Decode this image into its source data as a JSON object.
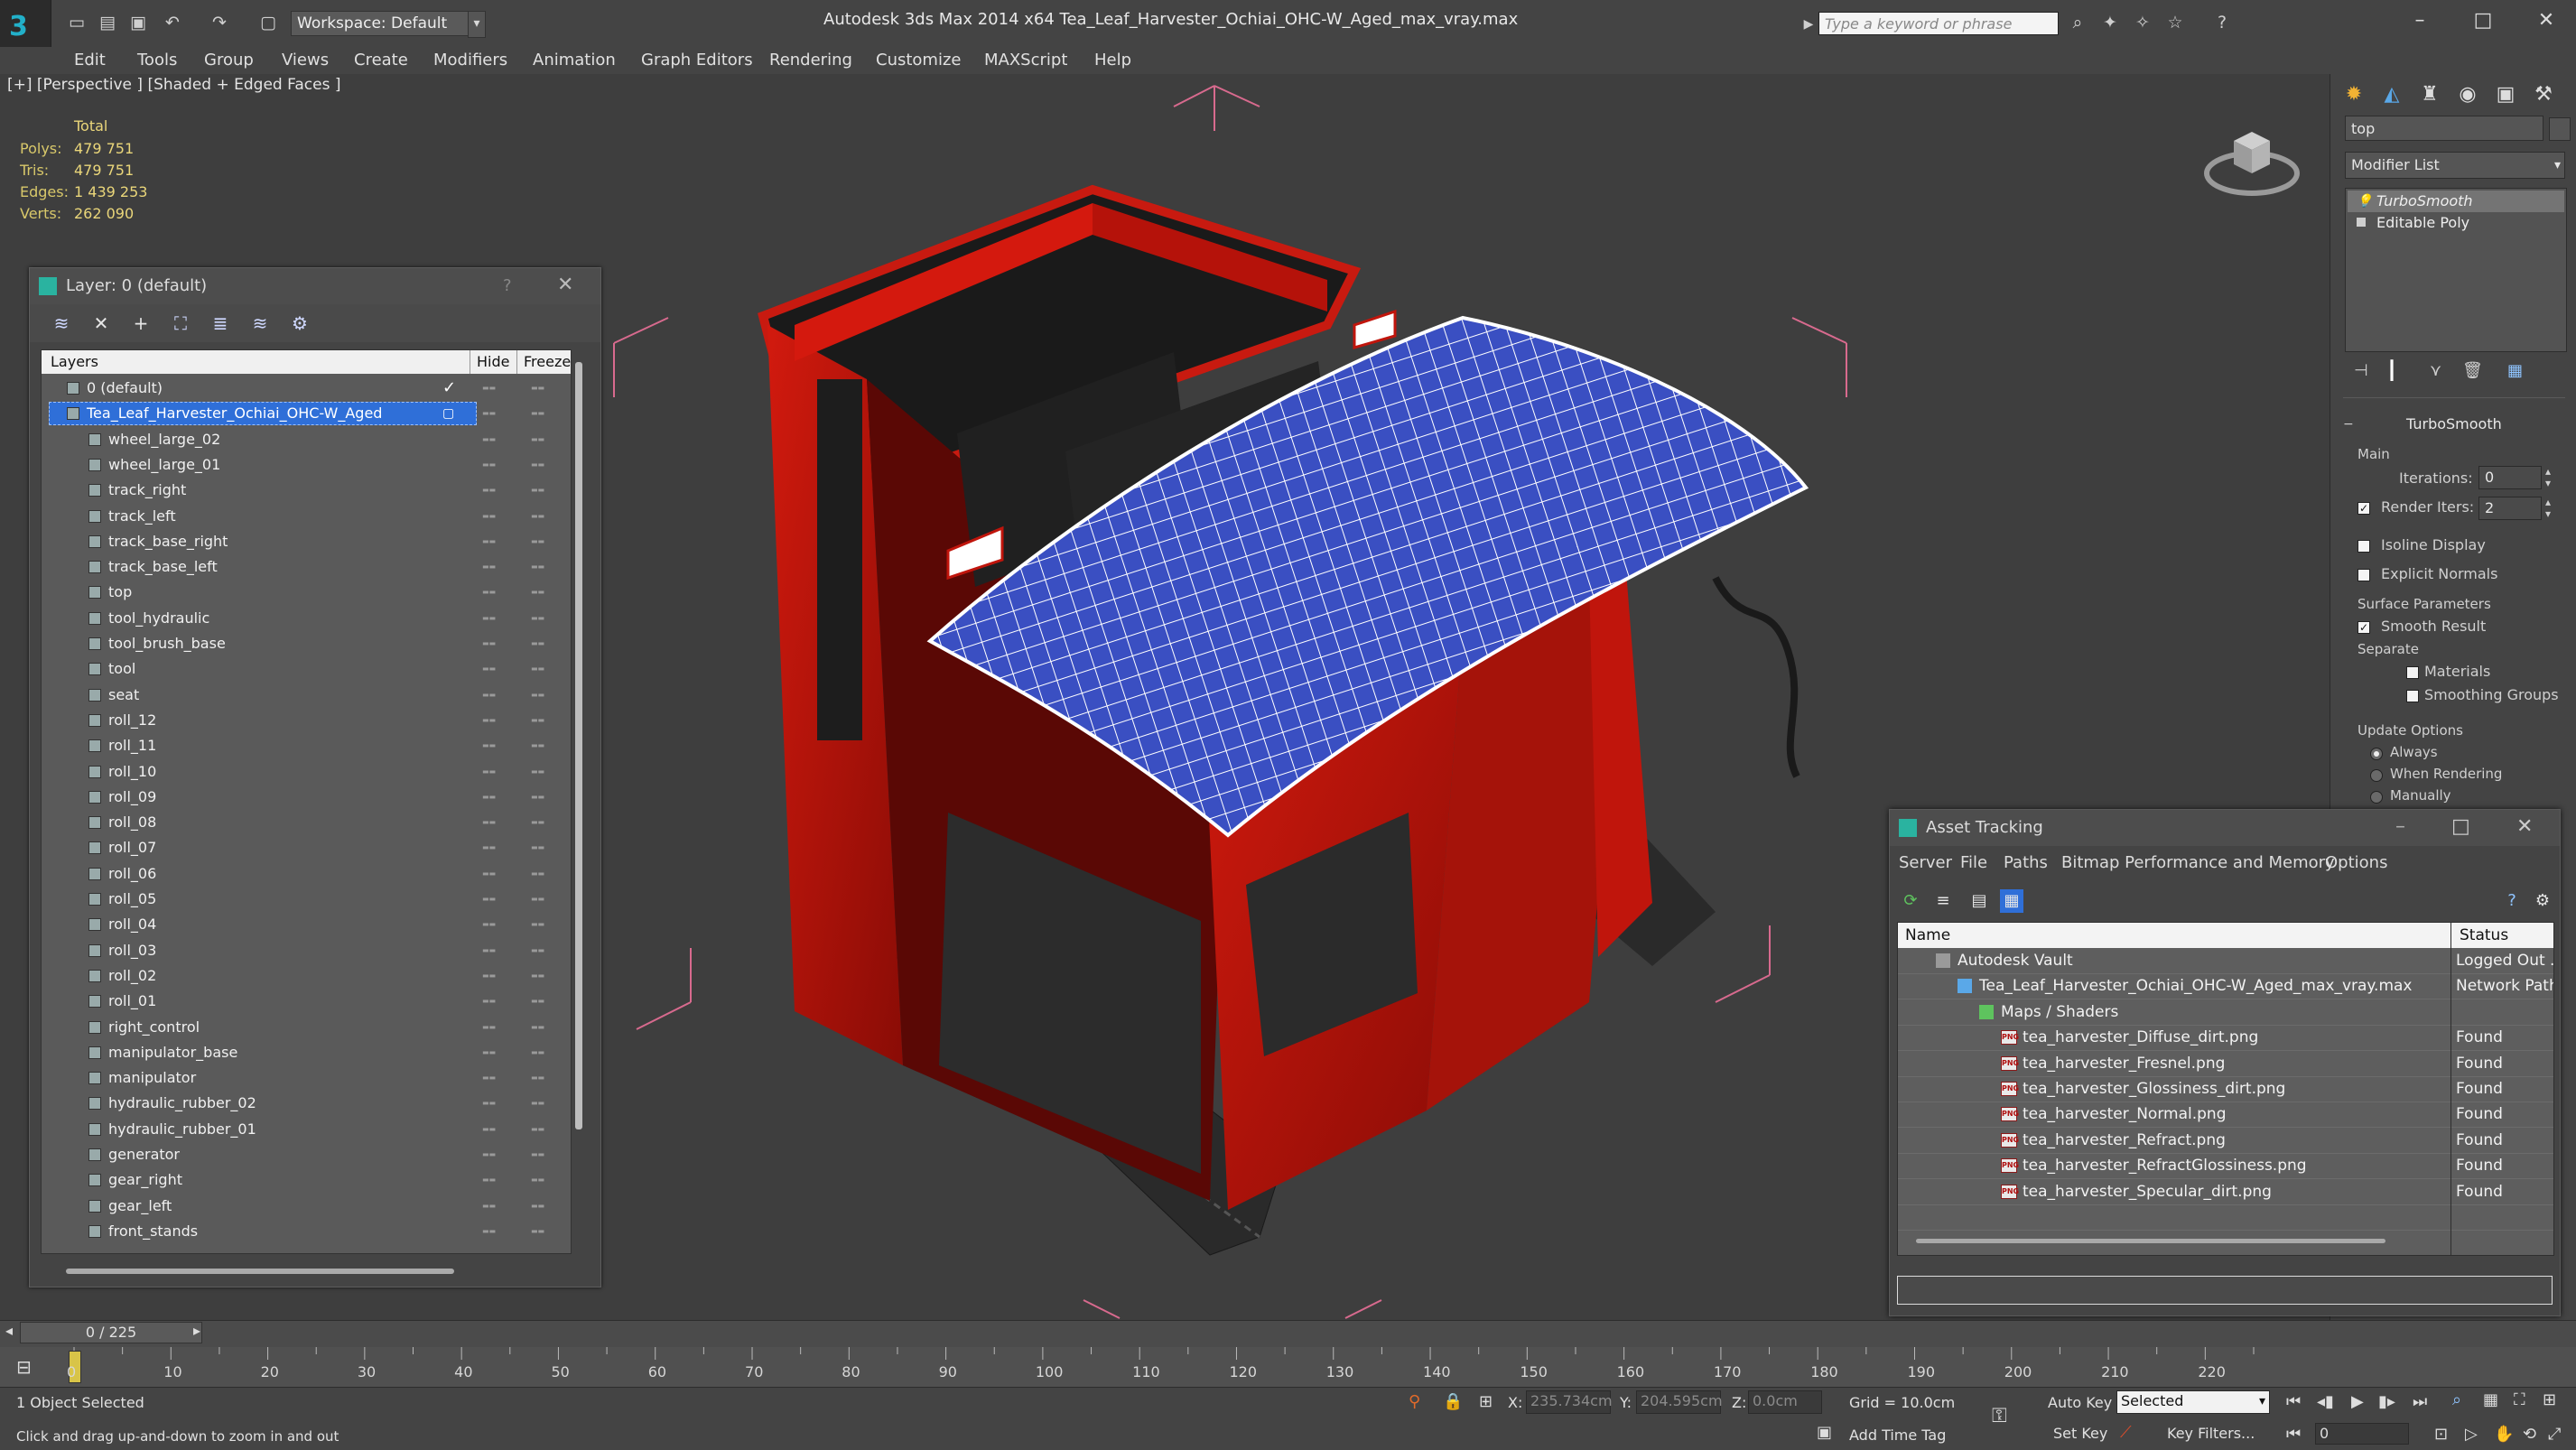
{
  "app": {
    "title": "Autodesk 3ds Max  2014 x64     Tea_Leaf_Harvester_Ochiai_OHC-W_Aged_max_vray.max",
    "workspace": "Workspace: Default",
    "search_placeholder": "Type a keyword or phrase"
  },
  "menu": [
    "Edit",
    "Tools",
    "Group",
    "Views",
    "Create",
    "Modifiers",
    "Animation",
    "Graph Editors",
    "Rendering",
    "Customize",
    "MAXScript",
    "Help"
  ],
  "viewport": {
    "label": "[+] [Perspective ] [Shaded + Edged Faces ]",
    "stats_header": "Total",
    "stats": [
      {
        "key": "Polys:",
        "value": "479 751"
      },
      {
        "key": "Tris:",
        "value": "479 751"
      },
      {
        "key": "Edges:",
        "value": "1 439 253"
      },
      {
        "key": "Verts:",
        "value": "262 090"
      }
    ]
  },
  "layer_panel": {
    "title": "Layer: 0 (default)",
    "help": "?",
    "columns": {
      "layers": "Layers",
      "hide": "Hide",
      "freeze": "Freeze"
    },
    "rows": [
      {
        "name": "0 (default)",
        "indent": 0
      },
      {
        "name": "Tea_Leaf_Harvester_Ochiai_OHC-W_Aged",
        "indent": 0
      },
      {
        "name": "wheel_large_02",
        "indent": 1
      },
      {
        "name": "wheel_large_01",
        "indent": 1
      },
      {
        "name": "track_right",
        "indent": 1
      },
      {
        "name": "track_left",
        "indent": 1
      },
      {
        "name": "track_base_right",
        "indent": 1
      },
      {
        "name": "track_base_left",
        "indent": 1
      },
      {
        "name": "top",
        "indent": 1
      },
      {
        "name": "tool_hydraulic",
        "indent": 1
      },
      {
        "name": "tool_brush_base",
        "indent": 1
      },
      {
        "name": "tool",
        "indent": 1
      },
      {
        "name": "seat",
        "indent": 1
      },
      {
        "name": "roll_12",
        "indent": 1
      },
      {
        "name": "roll_11",
        "indent": 1
      },
      {
        "name": "roll_10",
        "indent": 1
      },
      {
        "name": "roll_09",
        "indent": 1
      },
      {
        "name": "roll_08",
        "indent": 1
      },
      {
        "name": "roll_07",
        "indent": 1
      },
      {
        "name": "roll_06",
        "indent": 1
      },
      {
        "name": "roll_05",
        "indent": 1
      },
      {
        "name": "roll_04",
        "indent": 1
      },
      {
        "name": "roll_03",
        "indent": 1
      },
      {
        "name": "roll_02",
        "indent": 1
      },
      {
        "name": "roll_01",
        "indent": 1
      },
      {
        "name": "right_control",
        "indent": 1
      },
      {
        "name": "manipulator_base",
        "indent": 1
      },
      {
        "name": "manipulator",
        "indent": 1
      },
      {
        "name": "hydraulic_rubber_02",
        "indent": 1
      },
      {
        "name": "hydraulic_rubber_01",
        "indent": 1
      },
      {
        "name": "generator",
        "indent": 1
      },
      {
        "name": "gear_right",
        "indent": 1
      },
      {
        "name": "gear_left",
        "indent": 1
      },
      {
        "name": "front_stands",
        "indent": 1
      }
    ]
  },
  "command_panel": {
    "object_name": "top",
    "modifier_list": "Modifier List",
    "stack": [
      "TurboSmooth",
      "Editable Poly"
    ],
    "rollout_title": "TurboSmooth",
    "main_label": "Main",
    "iterations_label": "Iterations:",
    "iterations_value": "0",
    "render_iters_label": "Render Iters:",
    "render_iters_value": "2",
    "isoline": "Isoline Display",
    "explicit_normals": "Explicit Normals",
    "surface_params": "Surface Parameters",
    "smooth_result": "Smooth Result",
    "separate": "Separate",
    "materials": "Materials",
    "smoothing_groups": "Smoothing Groups",
    "update_options": "Update Options",
    "always": "Always",
    "when_rendering": "When Rendering",
    "manually": "Manually"
  },
  "asset_tracking": {
    "title": "Asset Tracking",
    "menu": [
      "Server",
      "File",
      "Paths",
      "Bitmap Performance and Memory",
      "Options"
    ],
    "columns": {
      "name": "Name",
      "status": "Status"
    },
    "rows": [
      {
        "name": "Autodesk Vault",
        "status": "Logged Out ...",
        "level": 0,
        "icon": "vault-icon"
      },
      {
        "name": "Tea_Leaf_Harvester_Ochiai_OHC-W_Aged_max_vray.max",
        "status": "Network Path",
        "level": 1,
        "icon": "max-file-icon"
      },
      {
        "name": "Maps / Shaders",
        "status": "",
        "level": 2,
        "icon": "maps-icon"
      },
      {
        "name": "tea_harvester_Diffuse_dirt.png",
        "status": "Found",
        "level": 3,
        "icon": "png-icon"
      },
      {
        "name": "tea_harvester_Fresnel.png",
        "status": "Found",
        "level": 3,
        "icon": "png-icon"
      },
      {
        "name": "tea_harvester_Glossiness_dirt.png",
        "status": "Found",
        "level": 3,
        "icon": "png-icon"
      },
      {
        "name": "tea_harvester_Normal.png",
        "status": "Found",
        "level": 3,
        "icon": "png-icon"
      },
      {
        "name": "tea_harvester_Refract.png",
        "status": "Found",
        "level": 3,
        "icon": "png-icon"
      },
      {
        "name": "tea_harvester_RefractGlossiness.png",
        "status": "Found",
        "level": 3,
        "icon": "png-icon"
      },
      {
        "name": "tea_harvester_Specular_dirt.png",
        "status": "Found",
        "level": 3,
        "icon": "png-icon"
      }
    ]
  },
  "timeline": {
    "slider": "0 / 225",
    "ticks": [
      "0",
      "10",
      "20",
      "30",
      "40",
      "50",
      "60",
      "70",
      "80",
      "90",
      "100",
      "110",
      "120",
      "130",
      "140",
      "150",
      "160",
      "170",
      "180",
      "190",
      "200",
      "210",
      "220"
    ]
  },
  "status": {
    "selection": "1 Object Selected",
    "prompt": "Click and drag up-and-down to zoom in and out",
    "x_label": "X:",
    "x_value": "235.734cm",
    "y_label": "Y:",
    "y_value": "204.595cm",
    "z_label": "Z:",
    "z_value": "0.0cm",
    "grid": "Grid = 10.0cm",
    "auto_key": "Auto Key",
    "selected_dropdown": "Selected",
    "set_key": "Set Key",
    "key_filters": "Key Filters...",
    "add_time_tag": "Add Time Tag",
    "frame": "0"
  },
  "colors": {
    "selection_blue": "#2f6fd8",
    "stats_yellow": "#ead67a",
    "machine_red": "#c0150c",
    "canopy_blue": "#3a4fc2"
  }
}
